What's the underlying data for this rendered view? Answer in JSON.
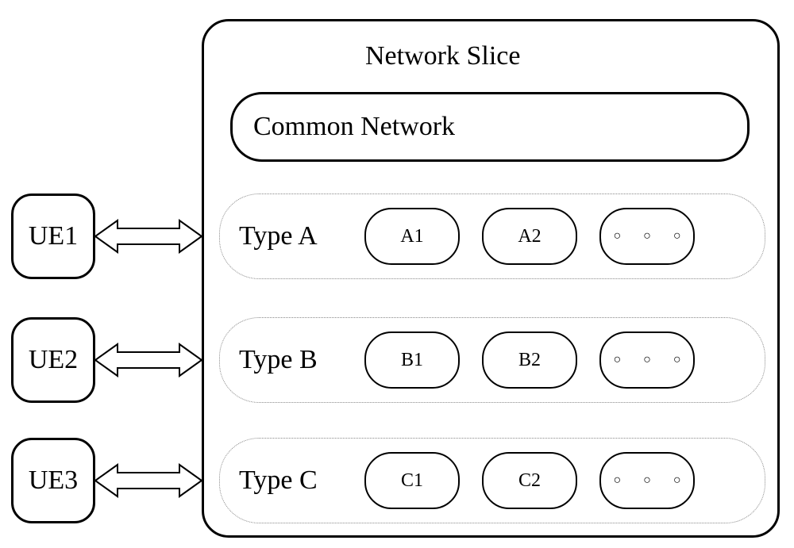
{
  "title": "Network Slice",
  "common": "Common Network",
  "ue": {
    "u1": "UE1",
    "u2": "UE2",
    "u3": "UE3"
  },
  "groups": {
    "a": {
      "label": "Type A",
      "p1": "A1",
      "p2": "A2",
      "more": "○  ○  ○"
    },
    "b": {
      "label": "Type B",
      "p1": "B1",
      "p2": "B2",
      "more": "○  ○  ○"
    },
    "c": {
      "label": "Type C",
      "p1": "C1",
      "p2": "C2",
      "more": "○  ○  ○"
    }
  }
}
